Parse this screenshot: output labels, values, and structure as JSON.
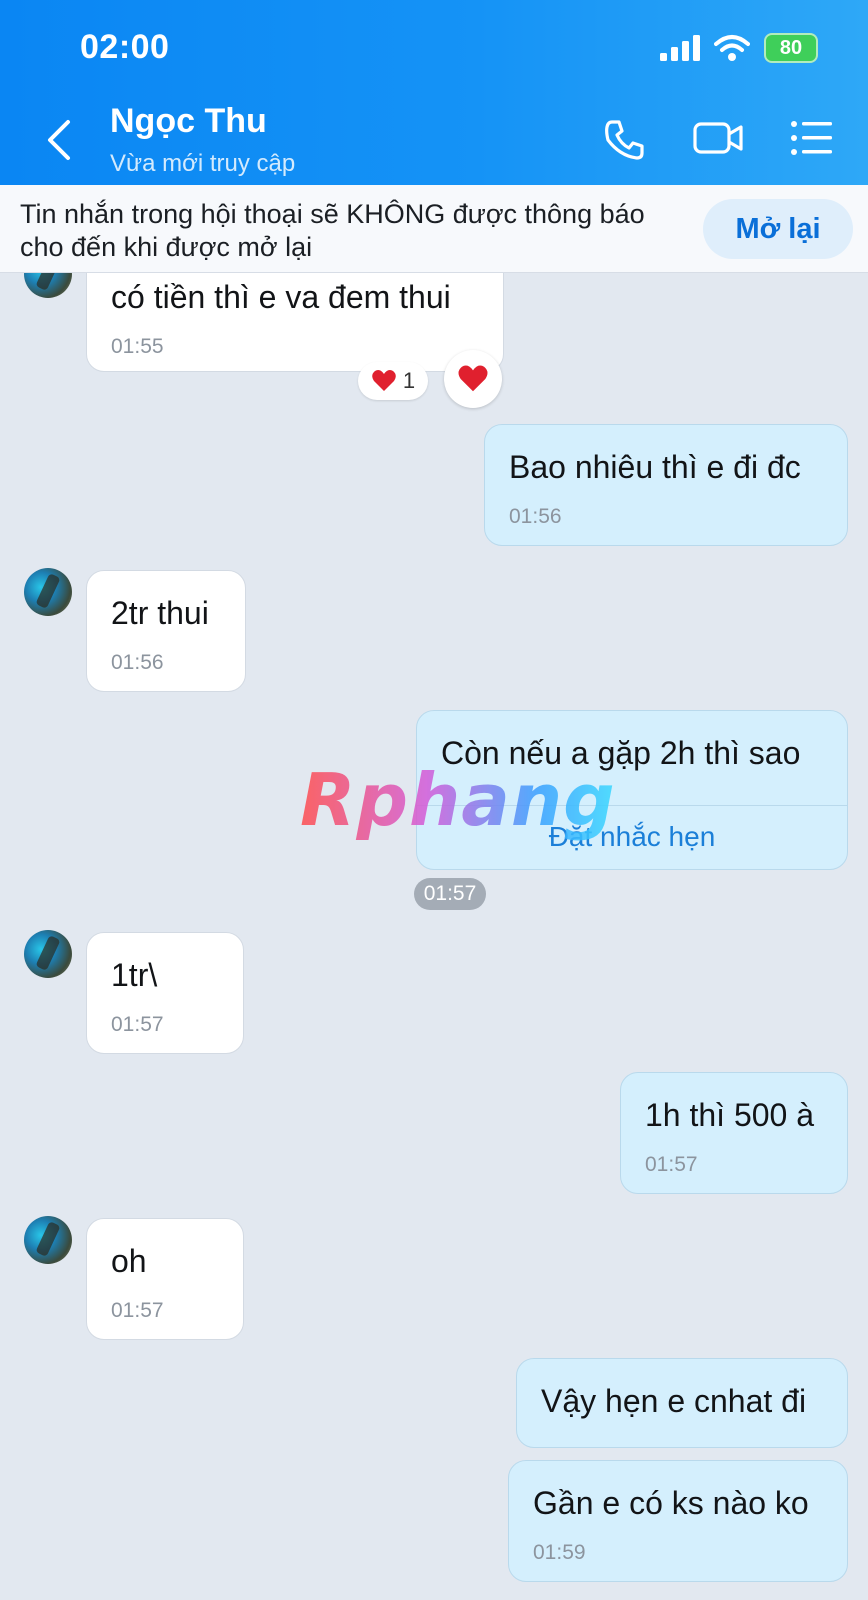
{
  "status_bar": {
    "time": "02:00",
    "battery": "80"
  },
  "header": {
    "name": "Ngọc Thu",
    "status": "Vừa mới truy cập"
  },
  "notice": {
    "text": "Tin nhắn trong hội thoại sẽ KHÔNG được thông báo cho đến khi được mở lại",
    "button": "Mở lại"
  },
  "messages": [
    {
      "side": "in",
      "text": "có tiền thì e va đem thui",
      "time": "01:55",
      "reaction_count": "1"
    },
    {
      "side": "out",
      "text": "Bao nhiêu thì e đi đc",
      "time": "01:56"
    },
    {
      "side": "in",
      "text": "2tr thui",
      "time": "01:56"
    },
    {
      "side": "out",
      "text": "Còn nếu a gặp 2h thì sao",
      "link": "Đặt nhắc hẹn",
      "time": "01:57"
    },
    {
      "side": "in",
      "text": "1tr\\",
      "time": "01:57"
    },
    {
      "side": "out",
      "text": "1h thì 500 à",
      "time": "01:57"
    },
    {
      "side": "in",
      "text": "oh",
      "time": "01:57"
    },
    {
      "side": "out",
      "text": "Vậy hẹn e cnhat đi"
    },
    {
      "side": "out",
      "text": "Gần e có ks nào ko",
      "time": "01:59"
    }
  ],
  "watermark": "Rphang",
  "colors": {
    "header_start": "#0a86f3",
    "header_end": "#2ea8f7",
    "out_bubble": "#d4effd",
    "in_bubble": "#ffffff",
    "link": "#1b7fd8"
  }
}
